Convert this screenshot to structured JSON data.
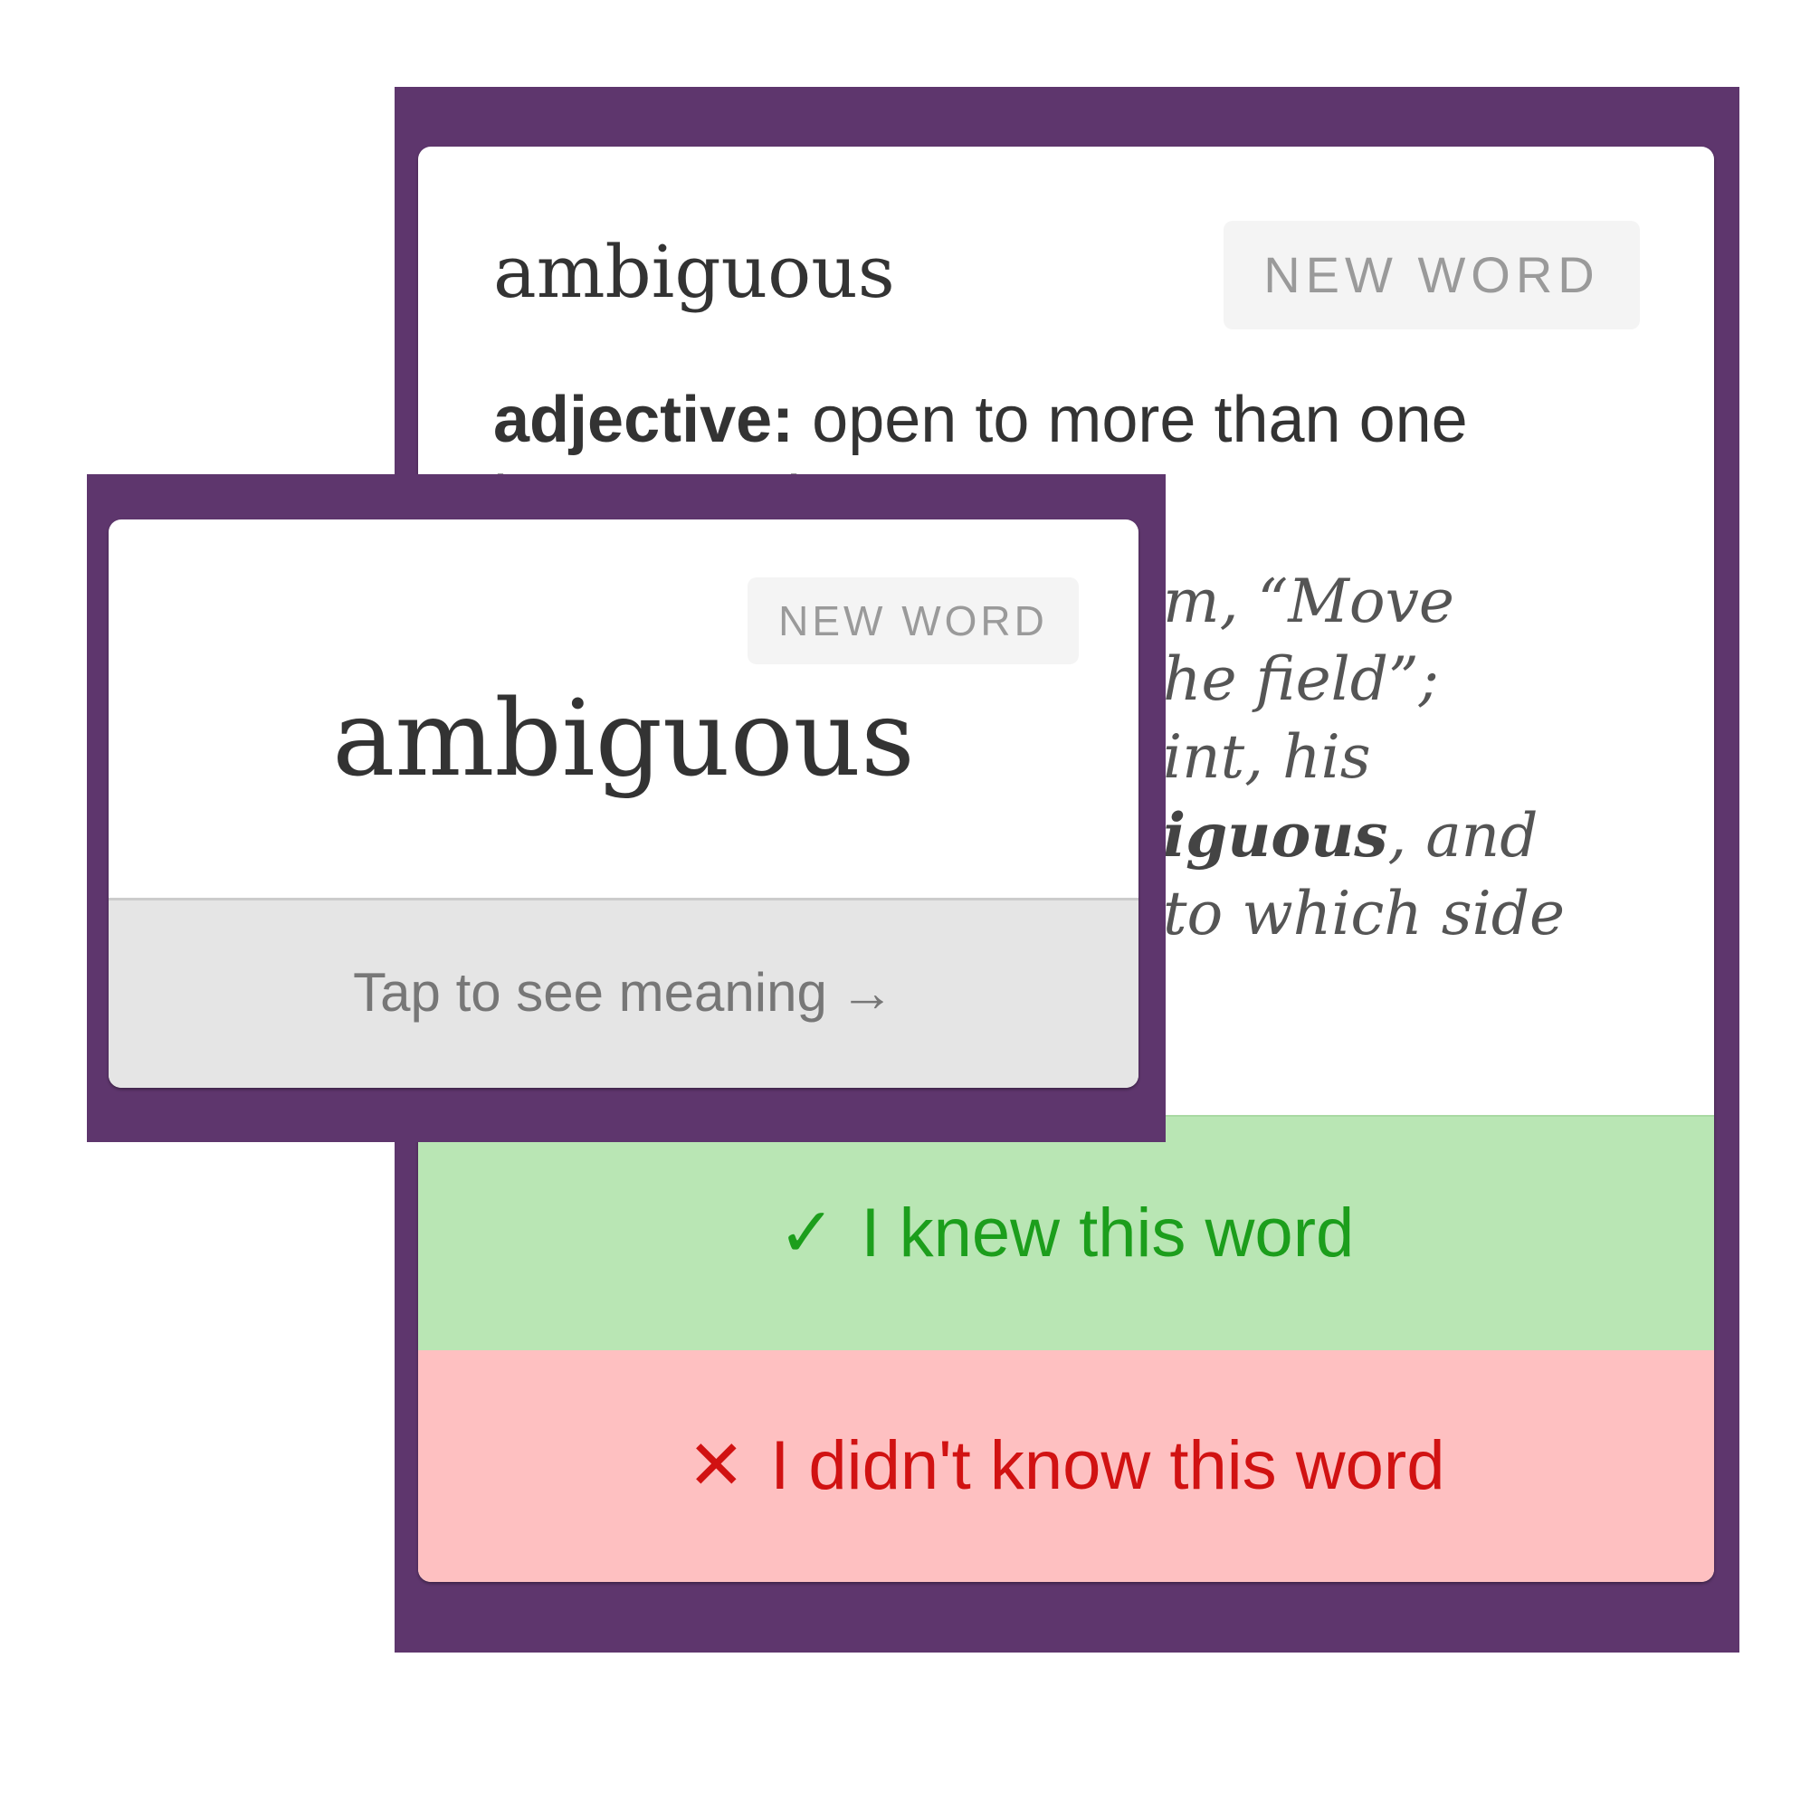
{
  "back_card": {
    "word": "ambiguous",
    "badge": "NEW WORD",
    "part_of_speech": "adjective:",
    "definition": "open to more than one interpretation",
    "example_line1": "m, “Move",
    "example_line2": "he field”;",
    "example_line3": "int, his",
    "example_bold": "iguous",
    "example_line4_rest": ", and",
    "example_line5": "to which side",
    "knew_button": {
      "icon": "check-icon",
      "glyph": "✓",
      "label": "I knew this word",
      "color": "#1c9e1c",
      "background": "#b9e6b4"
    },
    "didnt_button": {
      "icon": "cross-icon",
      "glyph": "✕",
      "label": "I didn't know this word",
      "color": "#d11212",
      "background": "#fec0c1"
    }
  },
  "front_card": {
    "badge": "NEW WORD",
    "word": "ambiguous",
    "tap_label": "Tap to see meaning",
    "tap_arrow": "→"
  },
  "colors": {
    "panel_background": "#5e366d",
    "card_background": "#ffffff",
    "badge_background": "#f4f4f4",
    "text": "#333333"
  }
}
